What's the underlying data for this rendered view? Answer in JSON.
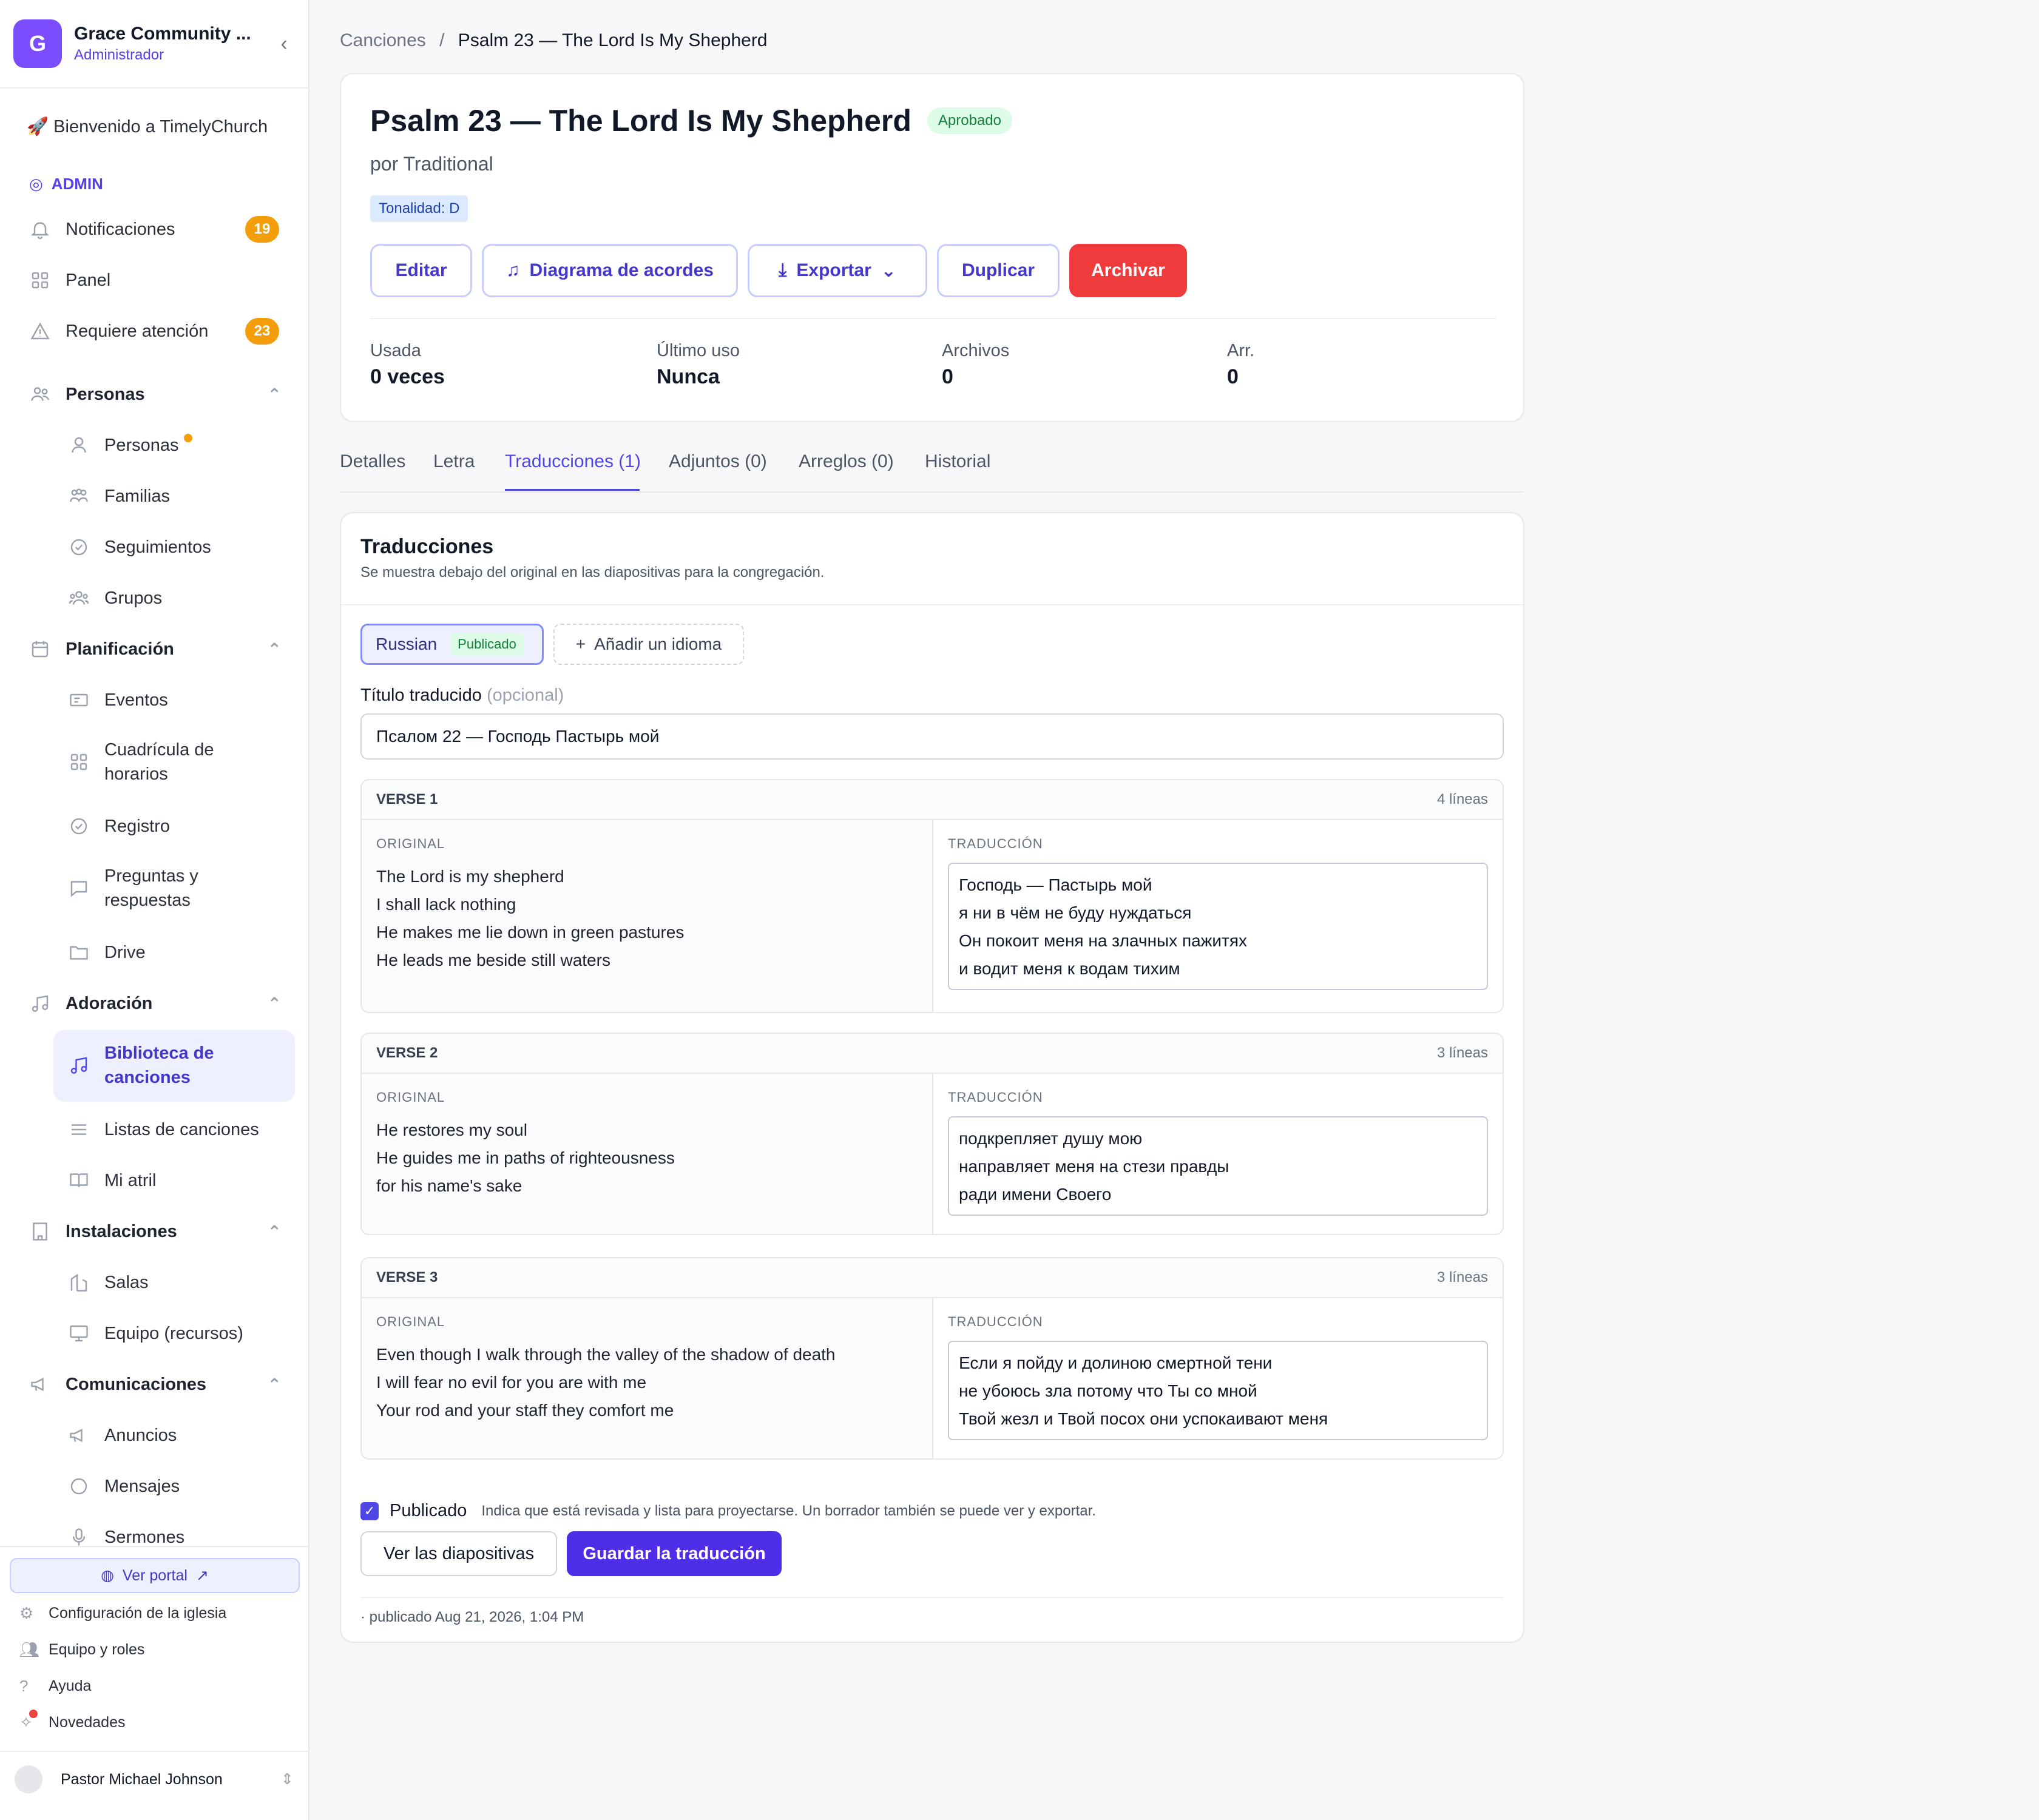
{
  "org": {
    "initial": "G",
    "name": "Grace Community ...",
    "role": "Administrador"
  },
  "welcome": "🚀 Bienvenido a TimelyChurch",
  "admin_label": "ADMIN",
  "nav": {
    "notifications": {
      "label": "Notificaciones",
      "count": "19"
    },
    "panel": "Panel",
    "attention": {
      "label": "Requiere atención",
      "count": "23"
    }
  },
  "sections": {
    "personas": {
      "title": "Personas",
      "items": [
        "Personas",
        "Familias",
        "Seguimientos",
        "Grupos"
      ]
    },
    "planificacion": {
      "title": "Planificación",
      "items": [
        "Eventos",
        "Cuadrícula de horarios",
        "Registro",
        "Preguntas y respuestas",
        "Drive"
      ]
    },
    "adoracion": {
      "title": "Adoración",
      "items": [
        "Biblioteca de canciones",
        "Listas de canciones",
        "Mi atril"
      ]
    },
    "instalaciones": {
      "title": "Instalaciones",
      "items": [
        "Salas",
        "Equipo (recursos)"
      ]
    },
    "comunicaciones": {
      "title": "Comunicaciones",
      "items": [
        "Anuncios",
        "Mensajes",
        "Sermones"
      ]
    }
  },
  "footer": {
    "portal": "Ver portal",
    "settings": "Configuración de la iglesia",
    "team": "Equipo y roles",
    "help": "Ayuda",
    "news": "Novedades",
    "user": "Pastor Michael Johnson"
  },
  "breadcrumb": {
    "parent": "Canciones",
    "current": "Psalm 23 — The Lord Is My Shepherd"
  },
  "song": {
    "title": "Psalm 23 — The Lord Is My Shepherd",
    "status": "Aprobado",
    "author": "por Traditional",
    "key": "Tonalidad: D",
    "buttons": {
      "edit": "Editar",
      "chords": "Diagrama de acordes",
      "export": "Exportar",
      "duplicate": "Duplicar",
      "archive": "Archivar"
    },
    "stats": [
      {
        "label": "Usada",
        "value": "0 veces"
      },
      {
        "label": "Último uso",
        "value": "Nunca"
      },
      {
        "label": "Archivos",
        "value": "0"
      },
      {
        "label": "Arr.",
        "value": "0"
      }
    ]
  },
  "tabs": [
    "Detalles",
    "Letra",
    "Traducciones (1)",
    "Adjuntos (0)",
    "Arreglos (0)",
    "Historial"
  ],
  "translations": {
    "title": "Traducciones",
    "subtitle": "Se muestra debajo del original en las diapositivas para la congregación.",
    "language": "Russian",
    "language_status": "Publicado",
    "add_language": "Añadir un idioma",
    "title_label": "Título traducido",
    "title_optional": "(opcional)",
    "title_value": "Псалом 22 — Господь Пастырь мой",
    "original_label": "ORIGINAL",
    "translation_label": "TRADUCCIÓN",
    "verses": [
      {
        "name": "VERSE 1",
        "lines": "4 líneas",
        "original": [
          "The Lord is my shepherd",
          "I shall lack nothing",
          "He makes me lie down in green pastures",
          "He leads me beside still waters"
        ],
        "translation": [
          "Господь — Пастырь мой",
          "я ни в чём не буду нуждаться",
          "Он покоит меня на злачных пажитях",
          "и водит меня к водам тихим"
        ]
      },
      {
        "name": "VERSE 2",
        "lines": "3 líneas",
        "original": [
          "He restores my soul",
          "He guides me in paths of righteousness",
          "for his name's sake"
        ],
        "translation": [
          "подкрепляет душу мою",
          "направляет меня на стези правды",
          "ради имени Своего"
        ]
      },
      {
        "name": "VERSE 3",
        "lines": "3 líneas",
        "original": [
          "Even though I walk through the valley of the shadow of death",
          "I will fear no evil for you are with me",
          "Your rod and your staff they comfort me"
        ],
        "translation": [
          "Если я пойду и долиною смертной тени",
          "не убоюсь зла потому что Ты со мной",
          "Твой жезл и Твой посох они успокаивают меня"
        ]
      }
    ],
    "published_label": "Publicado",
    "published_hint": "Indica que está revisada y lista para proyectarse. Un borrador también se puede ver y exportar.",
    "view_slides": "Ver las diapositivas",
    "save": "Guardar la traducción",
    "meta": "· publicado Aug 21, 2026, 1:04 PM"
  }
}
